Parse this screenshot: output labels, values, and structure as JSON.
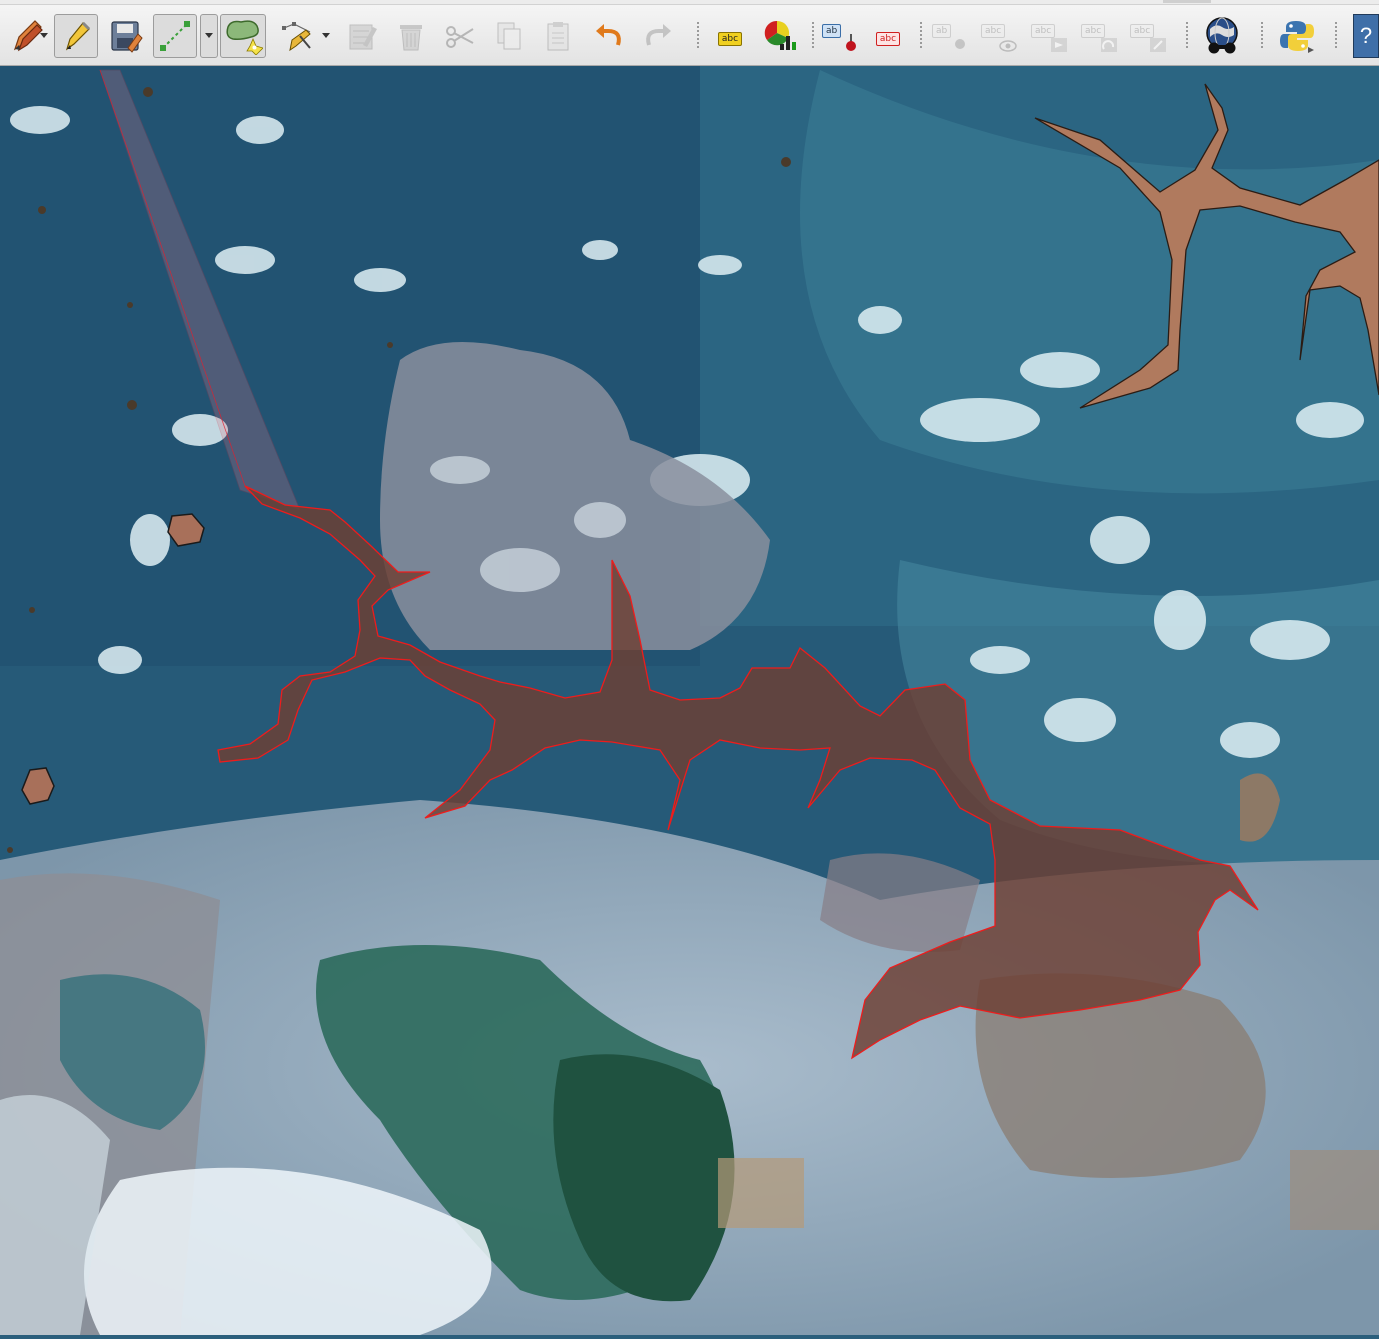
{
  "toolbar": {
    "buttons": [
      {
        "name": "current-edits-button",
        "icon": "pencils-icon"
      },
      {
        "name": "toggle-editing-button",
        "icon": "pencil-icon",
        "active": true
      },
      {
        "name": "save-layer-edits-button",
        "icon": "save-disk-icon"
      },
      {
        "name": "add-line-feature-button",
        "icon": "line-digitize-icon",
        "active": true
      },
      {
        "name": "add-polygon-feature-button",
        "icon": "polygon-icon",
        "active": true
      },
      {
        "name": "vertex-tool-button",
        "icon": "vertex-tool-icon"
      },
      {
        "name": "modify-attributes-button",
        "icon": "attribute-table-edit-icon",
        "disabled": true
      },
      {
        "name": "delete-selected-button",
        "icon": "trash-icon",
        "disabled": true
      },
      {
        "name": "cut-features-button",
        "icon": "scissors-icon",
        "disabled": true
      },
      {
        "name": "copy-features-button",
        "icon": "copy-icon",
        "disabled": true
      },
      {
        "name": "paste-features-button",
        "icon": "paste-icon",
        "disabled": true
      },
      {
        "name": "undo-button",
        "icon": "undo-icon"
      },
      {
        "name": "redo-button",
        "icon": "redo-icon",
        "disabled": true
      },
      {
        "name": "layer-labeling-button",
        "icon": "label-tag-icon"
      },
      {
        "name": "layer-diagram-button",
        "icon": "diagram-icon"
      },
      {
        "name": "highlight-pinned-labels-button",
        "icon": "label-pin-icon"
      },
      {
        "name": "pin-unpin-labels-button",
        "icon": "label-unpin-icon"
      },
      {
        "name": "show-hide-labels-button",
        "icon": "label-show-icon",
        "disabled": true
      },
      {
        "name": "move-label-button",
        "icon": "label-move-icon",
        "disabled": true
      },
      {
        "name": "rotate-label-button",
        "icon": "label-rotate-icon",
        "disabled": true
      },
      {
        "name": "change-label-button",
        "icon": "label-edit-icon",
        "disabled": true
      },
      {
        "name": "web-plugin-button",
        "icon": "globe-binoculars-icon"
      },
      {
        "name": "python-console-button",
        "icon": "python-icon"
      },
      {
        "name": "whats-this-button",
        "icon": "help-icon"
      }
    ],
    "label_text": {
      "yellow": "abc",
      "blue": "ab",
      "red": "abc",
      "disabled": "abc",
      "disabled_short": "ab"
    },
    "help_glyph": "?"
  },
  "map": {
    "description_colors": {
      "water": "#2b5f7c",
      "polygon_fill": "#8a5a48",
      "polygon_outline": "#e02020",
      "feature_fill": "#b07a5e"
    },
    "layers": [
      {
        "name": "satellite-imagery",
        "type": "raster"
      },
      {
        "name": "edited-polygon",
        "type": "vector",
        "state": "editing"
      }
    ]
  }
}
